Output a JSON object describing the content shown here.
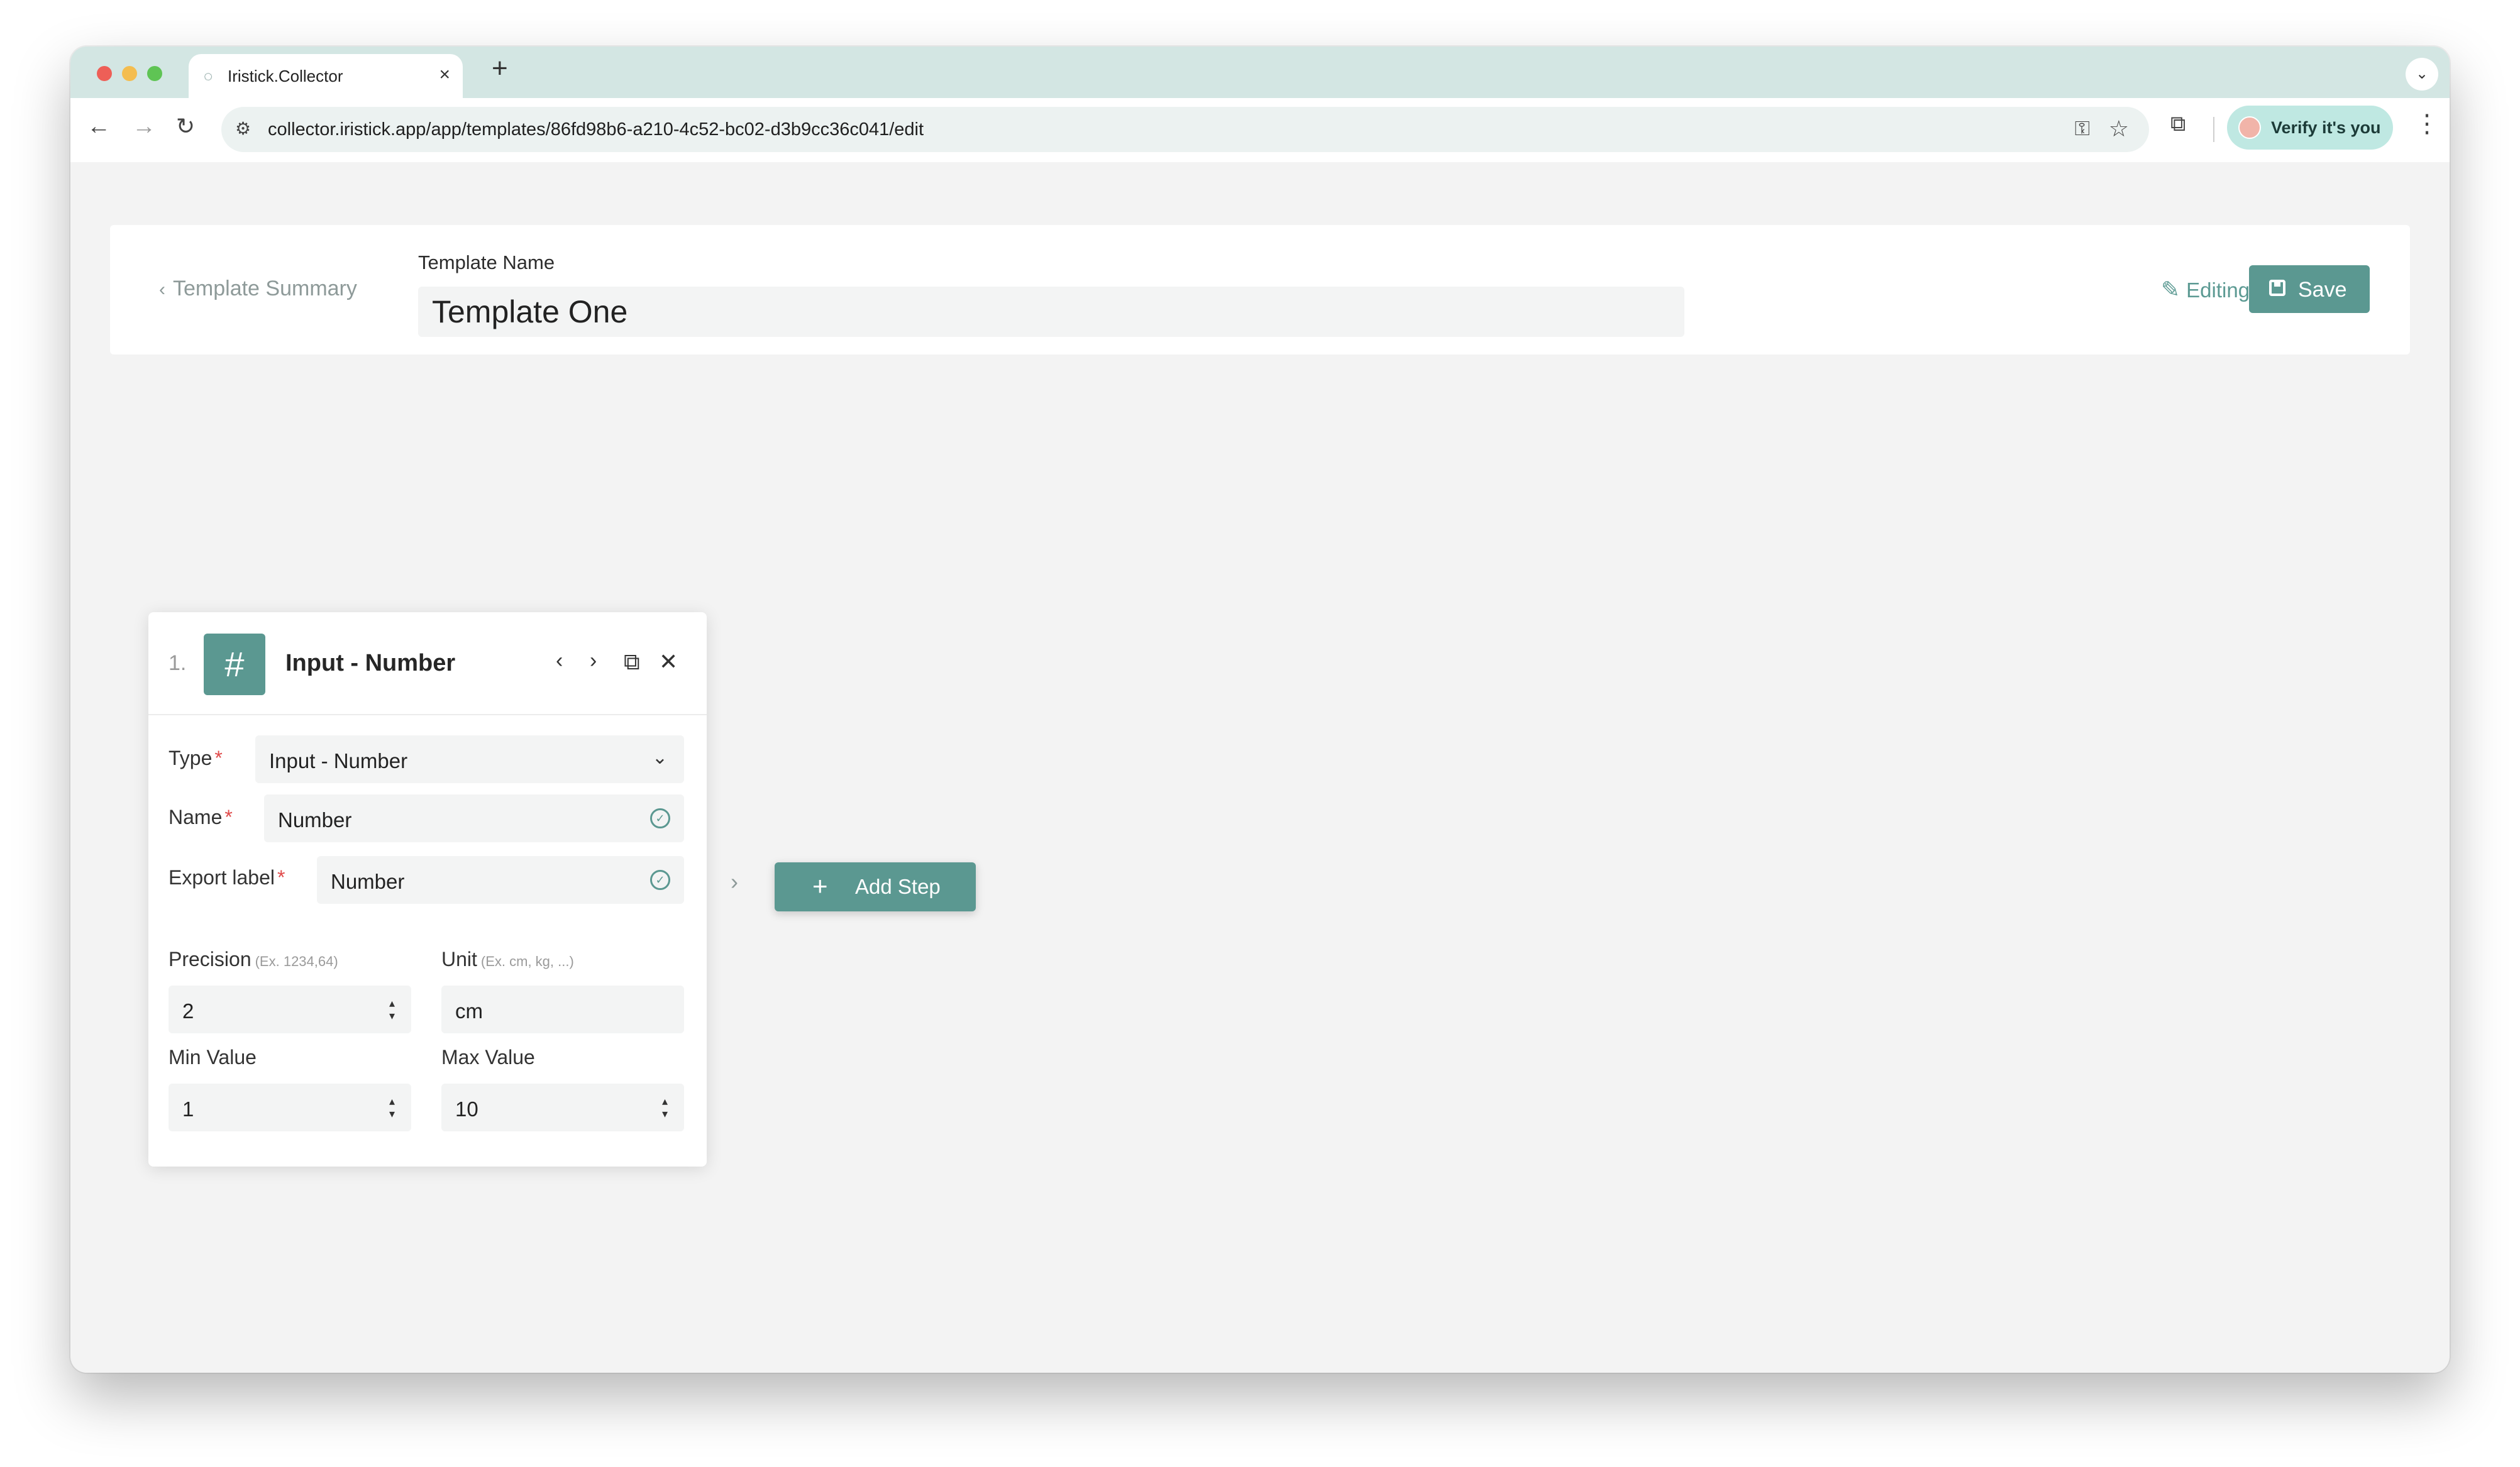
{
  "browser": {
    "tab_title": "Iristick.Collector",
    "url": "collector.iristick.app/app/templates/86fd98b6-a210-4c52-bc02-d3b9cc36c041/edit",
    "profile_label": "Verify it's you"
  },
  "header": {
    "back_label": "Template Summary",
    "template_name_label": "Template Name",
    "template_name_value": "Template One",
    "mode_label": "Editing",
    "save_label": "Save"
  },
  "step": {
    "number": "1.",
    "icon_glyph": "#",
    "title": "Input - Number",
    "fields": {
      "type": {
        "label": "Type",
        "value": "Input - Number"
      },
      "name": {
        "label": "Name",
        "value": "Number"
      },
      "export_label": {
        "label": "Export label",
        "value": "Number"
      },
      "precision": {
        "label": "Precision",
        "hint": "(Ex. 1234,64)",
        "value": "2"
      },
      "unit": {
        "label": "Unit",
        "hint": "(Ex. cm, kg, ...)",
        "value": "cm"
      },
      "min_value": {
        "label": "Min Value",
        "value": "1"
      },
      "max_value": {
        "label": "Max Value",
        "value": "10"
      }
    },
    "required_marker": "*"
  },
  "add_step_label": "Add Step",
  "colors": {
    "accent": "#5b9891",
    "tab_strip": "#d3e6e3",
    "page_bg": "#f3f3f3",
    "required": "#e04b4b"
  },
  "icons": [
    "arrow-left-icon",
    "arrow-right-icon",
    "reload-icon",
    "site-settings-icon",
    "key-icon",
    "star-icon",
    "extensions-icon",
    "kebab-menu-icon",
    "chevron-left-icon",
    "pencil-icon",
    "save-icon",
    "hash-icon",
    "chevron-right-icon",
    "copy-icon",
    "close-icon",
    "chevron-down-icon",
    "check-circle-icon",
    "stepper-icon",
    "plus-icon"
  ]
}
